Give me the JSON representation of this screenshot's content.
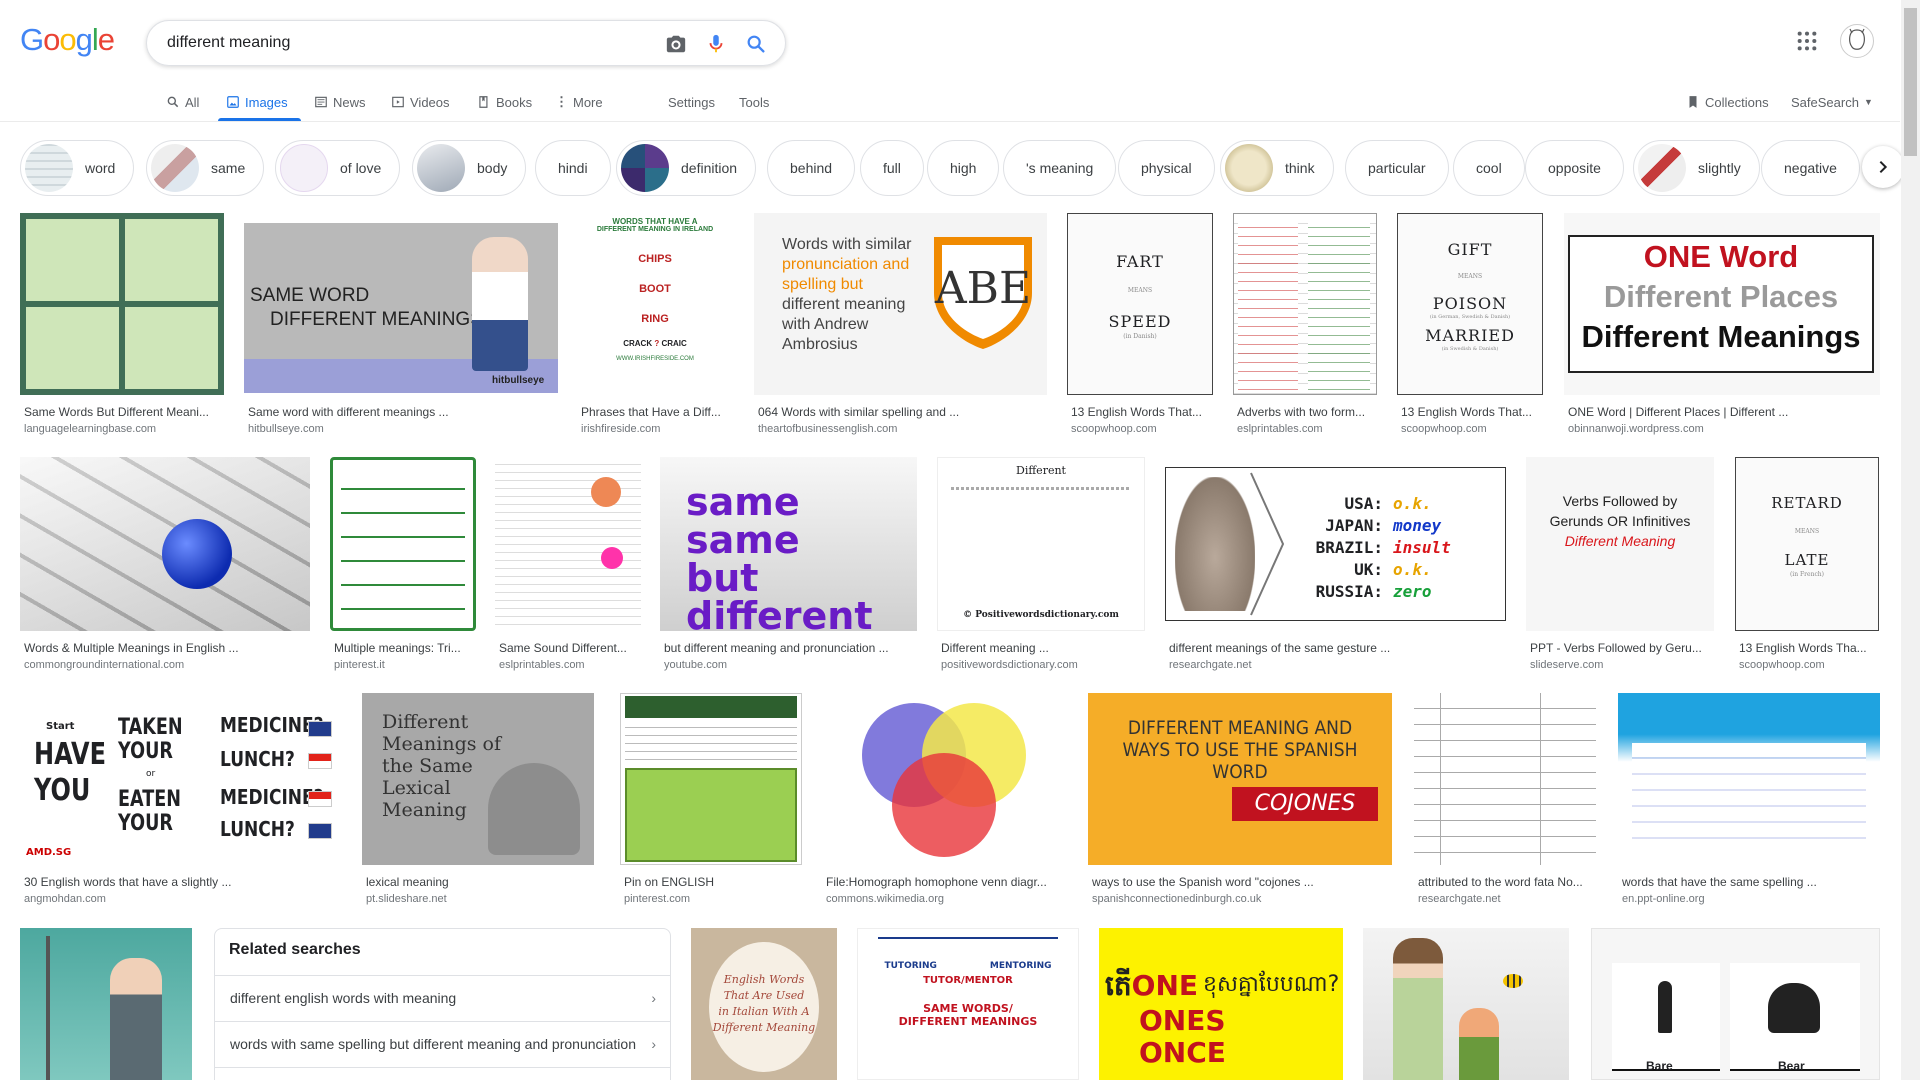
{
  "query": "different meaning",
  "tabs": [
    "All",
    "Images",
    "News",
    "Videos",
    "Books",
    "More"
  ],
  "tools": [
    "Settings",
    "Tools"
  ],
  "right_links": [
    "Collections",
    "SafeSearch"
  ],
  "chips": [
    "word",
    "same",
    "of love",
    "body",
    "hindi",
    "definition",
    "behind",
    "full",
    "high",
    "'s meaning",
    "physical",
    "think",
    "particular",
    "cool",
    "opposite",
    "slightly",
    "negative"
  ],
  "results": [
    {
      "title": "Same Words But Different Meani...",
      "source": "languagelearningbase.com"
    },
    {
      "title": "Same word with different meanings ...",
      "source": "hitbullseye.com"
    },
    {
      "title": "Phrases that Have a Diff...",
      "source": "irishfireside.com"
    },
    {
      "title": "064 Words with similar spelling and ...",
      "source": "theartofbusinessenglish.com"
    },
    {
      "title": "13 English Words That...",
      "source": "scoopwhoop.com"
    },
    {
      "title": "Adverbs with two form...",
      "source": "eslprintables.com"
    },
    {
      "title": "13 English Words That...",
      "source": "scoopwhoop.com"
    },
    {
      "title": "ONE Word | Different Places | Different ...",
      "source": "obinnanwoji.wordpress.com"
    },
    {
      "title": "Words & Multiple Meanings in English ...",
      "source": "commongroundinternational.com"
    },
    {
      "title": "Multiple meanings: Tri...",
      "source": "pinterest.it"
    },
    {
      "title": "Same Sound Different...",
      "source": "eslprintables.com"
    },
    {
      "title": "but different meaning and pronunciation ...",
      "source": "youtube.com"
    },
    {
      "title": "Different meaning ...",
      "source": "positivewordsdictionary.com"
    },
    {
      "title": "different meanings of the same gesture ...",
      "source": "researchgate.net"
    },
    {
      "title": "PPT - Verbs Followed by Geru...",
      "source": "slideserve.com"
    },
    {
      "title": "13 English Words Tha...",
      "source": "scoopwhoop.com"
    },
    {
      "title": "30 English words that have a slightly ...",
      "source": "angmohdan.com"
    },
    {
      "title": "lexical meaning",
      "source": "pt.slideshare.net"
    },
    {
      "title": "Pin on ENGLISH",
      "source": "pinterest.com"
    },
    {
      "title": "File:Homograph homophone venn diagr...",
      "source": "commons.wikimedia.org"
    },
    {
      "title": "ways to use the Spanish word \"cojones ...",
      "source": "spanishconnectionedinburgh.co.uk"
    },
    {
      "title": "attributed to the word fata No...",
      "source": "researchgate.net"
    },
    {
      "title": "words that have the same spelling ...",
      "source": "en.ppt-online.org"
    }
  ],
  "img_text": {
    "fart": [
      "FART",
      "MEANS",
      "SPEED",
      "(in Danish)"
    ],
    "gift": [
      "GIFT",
      "MEANS",
      "POISON",
      "(in German, Swedish & Danish)",
      "MARRIED",
      "(in Swedish & Danish)"
    ],
    "retard": [
      "RETARD",
      "MEANS",
      "LATE",
      "(in French)"
    ],
    "same_word": [
      "SAME WORD",
      "DIFFERENT MEANINGS",
      "hitbullseye"
    ],
    "irish": [
      "WORDS THAT HAVE A",
      "DIFFERENT MEANING IN IRELAND",
      "CHIPS",
      "BOOT",
      "RING",
      "CRACK",
      "?",
      "CRAIC",
      "WWW.IRISHFIRESIDE.COM"
    ],
    "similar": [
      "Words with similar",
      "pronunciation and",
      "spelling but",
      "different meaning",
      "with Andrew",
      "Ambrosius"
    ],
    "one_word": [
      "ONE Word",
      "Different Places",
      "Different Meanings"
    ],
    "same_same": [
      "same same",
      "but",
      "different"
    ],
    "gesture": [
      "USA:",
      "JAPAN:",
      "BRAZIL:",
      "UK:",
      "RUSSIA:",
      "o.k.",
      "money",
      "insult",
      "o.k.",
      "zero"
    ],
    "verbs": [
      "Verbs Followed by",
      "Gerunds OR Infinitives",
      "Different Meaning"
    ],
    "taken": [
      "Start",
      "HAVE",
      "YOU",
      "TAKEN",
      "YOUR",
      "or",
      "EATEN",
      "YOUR",
      "MEDICINE?",
      "LUNCH?",
      "MEDICINE?",
      "LUNCH?",
      "AMD.SG"
    ],
    "lexical": [
      "Different",
      "Meanings of",
      "the Same",
      "Lexical",
      "Meaning"
    ],
    "spanish": [
      "DIFFERENT MEANING AND",
      "WAYS TO USE THE SPANISH",
      "WORD",
      "COJONES"
    ],
    "positive": [
      "Different",
      "© Positivewordsdictionary.com"
    ],
    "cambodia": [
      "តើ",
      "ONE",
      "ខុសគ្នាបែបណា?",
      "ONES",
      "ONCE"
    ],
    "barebear": [
      "Bare",
      "Bear"
    ],
    "tutor": [
      "TUTORING",
      "MENTORING",
      "TUTOR/MENTOR",
      "SAME WORDS/",
      "DIFFERENT MEANINGS"
    ],
    "italian": [
      "English Words",
      "That Are Used",
      "in Italian With A",
      "Different Meaning"
    ]
  },
  "related": {
    "heading": "Related searches",
    "items": [
      "different english words with meaning",
      "words with same spelling but different meaning and pronunciation"
    ]
  },
  "colors": {
    "accent": "#1a73e8",
    "google_blue": "#4285f4",
    "google_red": "#ea4335",
    "google_yellow": "#fbbc05",
    "google_green": "#34a853"
  }
}
